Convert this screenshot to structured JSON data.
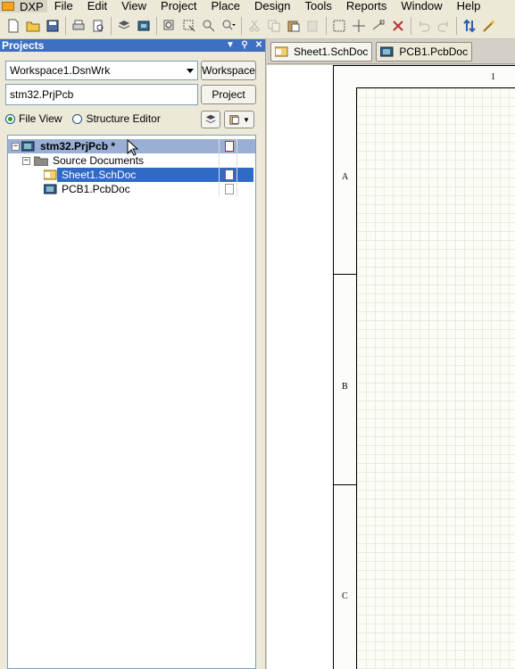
{
  "menu": {
    "dxp": "DXP",
    "items": [
      "File",
      "Edit",
      "View",
      "Project",
      "Place",
      "Design",
      "Tools",
      "Reports",
      "Window",
      "Help"
    ]
  },
  "toolbar": {
    "icons": [
      "new-doc-icon",
      "open-icon",
      "save-icon",
      "print-icon",
      "print-preview-icon",
      "layers-icon",
      "board-icon",
      "zoom-icon",
      "zoom-area-icon",
      "zoom-fit-icon",
      "zoom-dropdown-icon",
      "cut-icon",
      "copy-icon",
      "paste-icon",
      "paste-special-icon",
      "select-icon",
      "move-icon",
      "deselect-icon",
      "clear-icon",
      "undo-icon",
      "redo-icon",
      "sort-icon",
      "wand-icon"
    ]
  },
  "panel": {
    "title": "Projects",
    "workspace_value": "Workspace1.DsnWrk",
    "workspace_button": "Workspace",
    "project_value": "stm32.PrjPcb",
    "project_button": "Project",
    "file_view_label": "File View",
    "structure_editor_label": "Structure Editor",
    "file_view_selected": true
  },
  "tree": {
    "project": "stm32.PrjPcb *",
    "folder": "Source Documents",
    "files": [
      {
        "name": "Sheet1.SchDoc",
        "selected": true
      },
      {
        "name": "PCB1.PcbDoc",
        "selected": false
      }
    ]
  },
  "tabs": [
    {
      "label": "Sheet1.SchDoc",
      "icon": "schematic-icon",
      "active": true
    },
    {
      "label": "PCB1.PcbDoc",
      "icon": "pcb-icon",
      "active": false
    }
  ],
  "sheet": {
    "column_label": "1",
    "zones": [
      "A",
      "B",
      "C"
    ]
  },
  "colors": {
    "panel_header": "#3e6fc2",
    "selection": "#316ac5",
    "project_row": "#99afd4",
    "grid": "#eceade"
  }
}
